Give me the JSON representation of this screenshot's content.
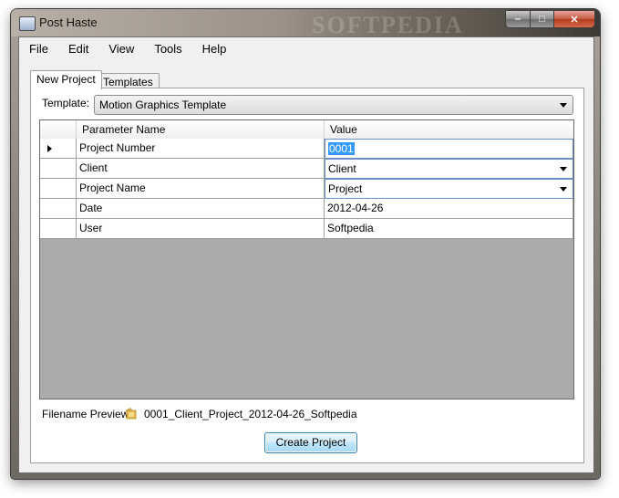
{
  "window": {
    "title": "Post Haste",
    "watermark": "SOFTPEDIA",
    "caption_buttons": {
      "minimize": "‒",
      "maximize": "□",
      "close": "✕"
    }
  },
  "menubar": {
    "items": [
      "File",
      "Edit",
      "View",
      "Tools",
      "Help"
    ]
  },
  "tabs": [
    {
      "label": "New Project",
      "active": true
    },
    {
      "label": "Templates",
      "active": false
    }
  ],
  "template": {
    "label": "Template:",
    "value": "Motion Graphics Template"
  },
  "grid": {
    "columns": [
      "Parameter Name",
      "Value"
    ],
    "rows": [
      {
        "name": "Project Number",
        "value": "0001",
        "editor": "text",
        "current": true
      },
      {
        "name": "Client",
        "value": "Client",
        "editor": "combo"
      },
      {
        "name": "Project Name",
        "value": "Project",
        "editor": "combo"
      },
      {
        "name": "Date",
        "value": "2012-04-26",
        "editor": "text"
      },
      {
        "name": "User",
        "value": "Softpedia",
        "editor": "text"
      }
    ]
  },
  "filename_preview": {
    "label": "Filename Preview:",
    "value": "0001_Client_Project_2012-04-26_Softpedia",
    "icon": "folder-icon"
  },
  "create_button": {
    "label": "Create Project"
  },
  "colors": {
    "selection": "#3399ff",
    "grid_background": "#ababab",
    "button_border": "#3c7fb1"
  }
}
